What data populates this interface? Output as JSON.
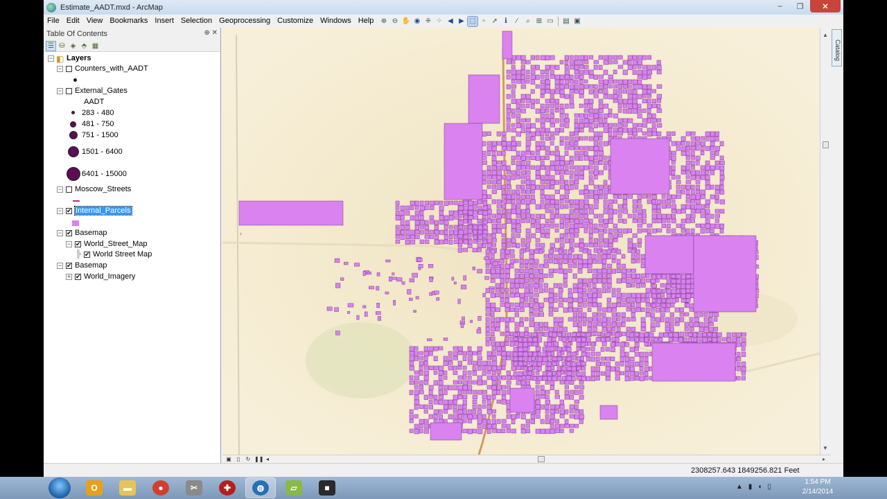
{
  "window": {
    "title": "Estimate_AADT.mxd - ArcMap",
    "controls": [
      "–",
      "❐",
      "✕"
    ]
  },
  "menu": [
    "File",
    "Edit",
    "View",
    "Bookmarks",
    "Insert",
    "Selection",
    "Geoprocessing",
    "Customize",
    "Windows",
    "Help"
  ],
  "toc": {
    "title": "Table Of Contents",
    "header_buttons": "⊕ ✕",
    "layers_root": "Layers",
    "layer_counters": "Counters_with_AADT",
    "layer_gates": "External_Gates",
    "gates_field": "AADT",
    "gates_classes": [
      "283 - 480",
      "481 - 750",
      "751 - 1500",
      "1501 - 6400",
      "6401 - 15000"
    ],
    "layer_streets": "Moscow_Streets",
    "layer_parcels": "Internal_Parcels",
    "basemap1": "Basemap",
    "world_street_map_group": "World_Street_Map",
    "world_street_map": "World Street Map",
    "basemap2": "Basemap",
    "world_imagery": "World_Imagery"
  },
  "map": {
    "parcel_color": "#d982f0",
    "parcel_stroke": "#7d3a8c",
    "background_color": "#f5ecd4"
  },
  "status": {
    "coordinates": "2308257.643  1849256.821 Feet"
  },
  "side_tab": {
    "catalog": "Catalog"
  },
  "clock": {
    "time": "1:54 PM",
    "date": "2/14/2014"
  },
  "taskbar_items": [
    "Outlook",
    "Explorer",
    "Chrome",
    "Snipping Tool",
    "Rescue",
    "ArcMap",
    "Notes",
    "Camtasia"
  ]
}
